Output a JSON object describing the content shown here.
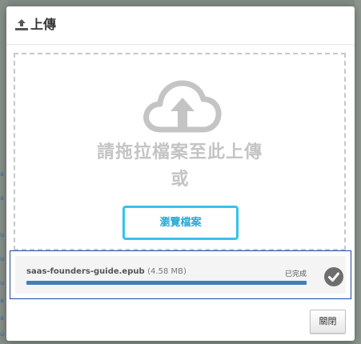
{
  "dialog": {
    "title": "上傳",
    "header_icon": "upload-icon"
  },
  "dropzone": {
    "icon": "cloud-upload-icon",
    "drop_text": "請拖拉檔案至此上傳",
    "or_text": "或",
    "browse_label": "瀏覽檔案"
  },
  "file": {
    "name": "saas-founders-guide.epub",
    "size": "(4.58 MB)",
    "status": "已完成",
    "progress": 1.0,
    "status_icon": "check-circle-icon"
  },
  "footer": {
    "close_label": "關閉"
  },
  "background": {
    "left_fragments": [
      "a",
      "a",
      "u",
      "u",
      "u",
      "a",
      "a",
      "u"
    ]
  },
  "colors": {
    "accent": "#36c3ec",
    "accent_text": "#2aa9d8",
    "progress": "#3d7fbe",
    "selection_border": "#1f46a8",
    "muted_text": "#c4c4c4"
  }
}
